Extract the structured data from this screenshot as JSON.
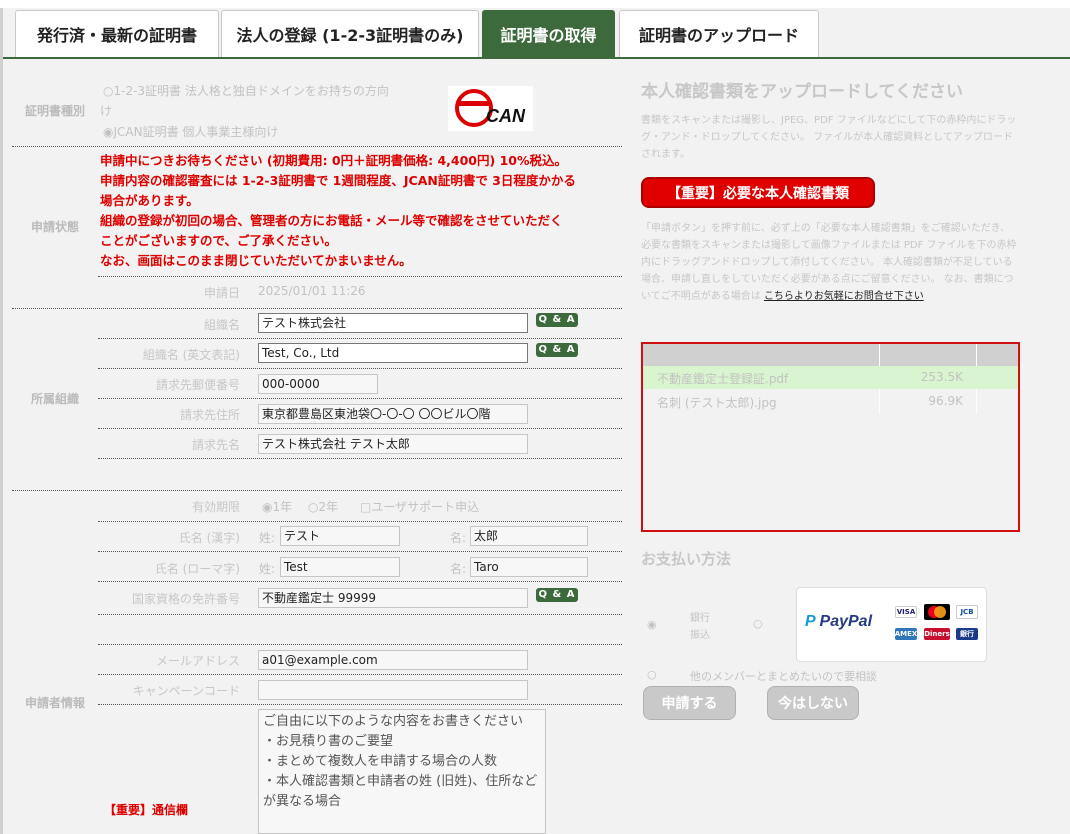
{
  "tabs": [
    {
      "label": "発行済・最新の証明書"
    },
    {
      "label": "法人の登録 (1-2-3証明書のみ)"
    },
    {
      "label": "証明書の取得"
    },
    {
      "label": "証明書のアップロード"
    }
  ],
  "cert_type": {
    "section_label": "証明書種別",
    "option1": "1-2-3証明書 法人格と独自ドメインをお持ちの方向",
    "option1_wrap": "け",
    "option2": "JCAN証明書 個人事業主様向け",
    "logo_text": "CAN"
  },
  "status": {
    "section_label": "申請状態",
    "messages": [
      "申請中につきお待ちください (初期費用: 0円＋証明書価格: 4,400円) 10%税込。",
      "申請内容の確認審査には 1-2-3証明書で 1週間程度、JCAN証明書で 3日程度かかる",
      "場合があります。",
      "組織の登録が初回の場合、管理者の方にお電話・メール等で確認をさせていただく",
      "ことがございますので、ご了承ください。",
      "なお、画面はこのまま閉じていただいてかまいません。"
    ],
    "date_label": "申請日",
    "date_value": "2025/01/01 11:26"
  },
  "org": {
    "section_label": "所属組織",
    "name_label": "組織名",
    "name_value": "テスト株式会社",
    "name_en_label": "組織名 (英文表記)",
    "name_en_value": "Test, Co., Ltd",
    "zip_label": "請求先郵便番号",
    "zip_value": "000-0000",
    "addr_label": "請求先住所",
    "addr_value": "東京都豊島区東池袋〇-〇-〇 〇〇ビル〇階",
    "bill_name_label": "請求先名",
    "bill_name_value": "テスト株式会社 テスト太郎",
    "qa_label": "Q & A"
  },
  "applicant": {
    "section_label": "申請者情報",
    "validity_label": "有効期限",
    "validity_1y": "1年",
    "validity_2y": "2年",
    "user_support": "ユーザサポート申込",
    "name_kanji_label": "氏名 (漢字)",
    "last_prefix": "姓:",
    "first_prefix": "名:",
    "last_kanji": "テスト",
    "first_kanji": "太郎",
    "name_roman_label": "氏名 (ローマ字)",
    "last_roman": "Test",
    "first_roman": "Taro",
    "license_label": "国家資格の免許番号",
    "license_value": "不動産鑑定士 99999",
    "email_label": "メールアドレス",
    "email_value": "a01@example.com",
    "campaign_label": "キャンペーンコード",
    "campaign_value": "",
    "comm_label": "【重要】通信欄",
    "comm_placeholder": "ご自由に以下のような内容をお書きください\n・お見積り書のご要望\n・まとめて複数人を申請する場合の人数\n・本人確認書類と申請者の姓 (旧姓)、住所など\nが異なる場合"
  },
  "upload": {
    "title": "本人確認書類をアップロードしてください",
    "desc": "書類をスキャンまたは撮影し、JPEG、PDF ファイルなどにして下の赤枠内にドラッグ・アンド・ドロップしてください。 ファイルが本人確認資料としてアップロードされます。",
    "important_button": "【重要】必要な本人確認書類",
    "note": "「申請ボタン」を押す前に、必ず上の「必要な本人確認書類」をご確認いただき、 必要な書類をスキャンまたは撮影して画像ファイルまたは PDF ファイルを下の赤枠内にドラッグアンドドロップして添付してください。 本人確認書類が不足している場合、申請し直しをしていただく必要がある点にご留意ください。 なお、書類についてご不明点がある場合は ",
    "note_link": "こちらよりお気軽にお問合せ下さい",
    "files": [
      {
        "name": "不動産鑑定士登録証.pdf",
        "size": "253.5K"
      },
      {
        "name": "名刺 (テスト太郎).jpg",
        "size": "96.9K"
      }
    ]
  },
  "payment": {
    "title": "お支払い方法",
    "bank_line1": "銀行",
    "bank_line2": "振込",
    "paypal": "PayPal",
    "other": "他のメンバーとまとめたいので要相談",
    "cards": [
      "VISA",
      "MC",
      "JCB",
      "AMEX",
      "Diners",
      "銀行"
    ]
  },
  "actions": {
    "apply": "申請する",
    "later": "今はしない"
  }
}
